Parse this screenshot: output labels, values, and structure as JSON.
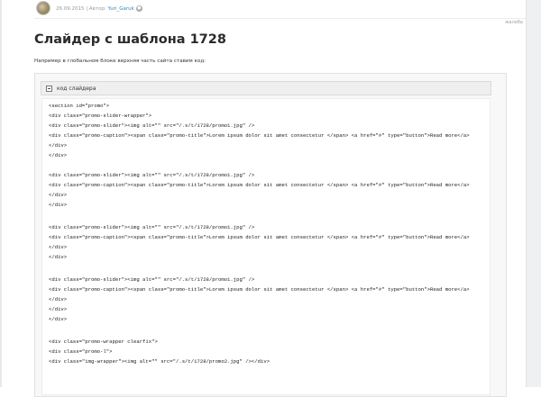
{
  "meta": {
    "date": "26.09.2015",
    "separator": "|",
    "author_label": "Автор:",
    "author_name": "Yuri_Garuk"
  },
  "complaint_label": "жалоба",
  "title": "Слайдер с шаблона 1728",
  "intro": "Например в глобальном блоке верхняя часть сайта ставим код:",
  "spoiler": {
    "label": "код слайдера"
  },
  "code_lines": [
    "<section id=\"promo\">",
    "<div class=\"promo-slider-wrapper\">",
    "<div class=\"promo-slider\"><img alt=\"\" src=\"/.s/t/1728/promo1.jpg\" />",
    "<div class=\"promo-caption\"><span class=\"promo-title\">Lorem ipsum dolor sit amet consectetur </span> <a href=\"#\" type=\"button\">Read more</a>",
    "</div>",
    "</div>",
    "",
    "<div class=\"promo-slider\"><img alt=\"\" src=\"/.s/t/1728/promo1.jpg\" />",
    "<div class=\"promo-caption\"><span class=\"promo-title\">Lorem ipsum dolor sit amet consectetur </span> <a href=\"#\" type=\"button\">Read more</a>",
    "</div>",
    "</div>",
    "",
    "<div class=\"promo-slider\"><img alt=\"\" src=\"/.s/t/1728/promo1.jpg\" />",
    "<div class=\"promo-caption\"><span class=\"promo-title\">Lorem ipsum dolor sit amet consectetur </span> <a href=\"#\" type=\"button\">Read more</a>",
    "</div>",
    "</div>",
    "",
    "<div class=\"promo-slider\"><img alt=\"\" src=\"/.s/t/1728/promo1.jpg\" />",
    "<div class=\"promo-caption\"><span class=\"promo-title\">Lorem ipsum dolor sit amet consectetur </span> <a href=\"#\" type=\"button\">Read more</a>",
    "</div>",
    "</div>",
    "</div>",
    "",
    "<div class=\"promo-wrapper clearfix\">",
    "<div class=\"promo-l\">",
    "<div class=\"img-wrapper\"><img alt=\"\" src=\"/.s/t/1728/promo2.jpg\" /></div>"
  ]
}
